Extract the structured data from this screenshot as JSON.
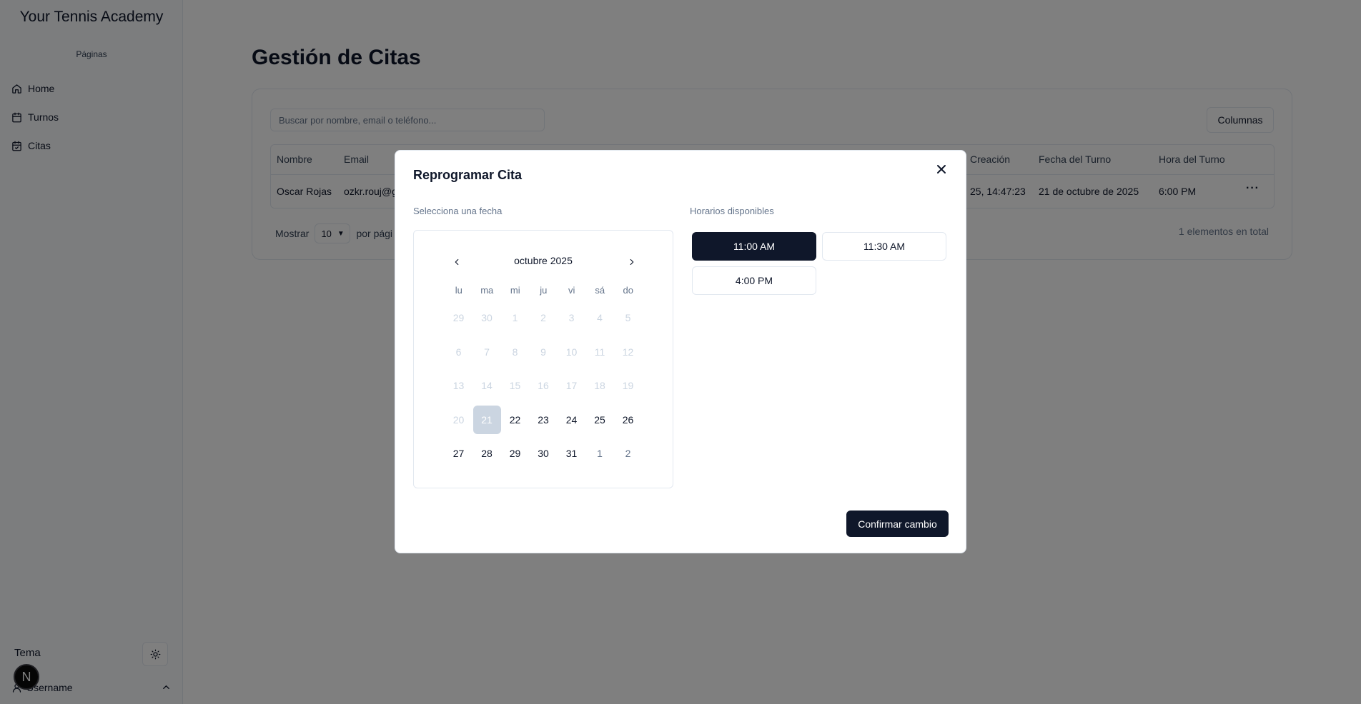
{
  "sidebar": {
    "brand": "Your Tennis Academy",
    "section_label": "Páginas",
    "items": [
      {
        "label": "Home",
        "icon": "home-icon"
      },
      {
        "label": "Turnos",
        "icon": "calendar-icon"
      },
      {
        "label": "Citas",
        "icon": "calendar-check-icon"
      }
    ],
    "theme_label": "Tema",
    "avatar_letter": "N",
    "username": "Username"
  },
  "main": {
    "title": "Gestión de Citas",
    "search_placeholder": "Buscar por nombre, email o teléfono...",
    "columns_button": "Columnas",
    "table": {
      "headers": [
        "Nombre",
        "Email",
        "Creación",
        "Fecha del Turno",
        "Hora del Turno"
      ],
      "row": [
        "Oscar Rojas",
        "ozkr.rouj@g",
        "25, 14:47:23",
        "21 de octubre de 2025",
        "6:00 PM"
      ],
      "row_menu": "···"
    },
    "footer": {
      "show_label": "Mostrar",
      "page_size": "10",
      "per_page_text": "por pági",
      "total_text": "1 elementos en total"
    }
  },
  "modal": {
    "title": "Reprogramar Cita",
    "date_label": "Selecciona una fecha",
    "slots_label": "Horarios disponibles",
    "calendar": {
      "month": "octubre 2025",
      "weekdays": [
        "lu",
        "ma",
        "mi",
        "ju",
        "vi",
        "sá",
        "do"
      ],
      "days": [
        {
          "d": "29",
          "s": "disabled"
        },
        {
          "d": "30",
          "s": "disabled"
        },
        {
          "d": "1",
          "s": "disabled"
        },
        {
          "d": "2",
          "s": "disabled"
        },
        {
          "d": "3",
          "s": "disabled"
        },
        {
          "d": "4",
          "s": "disabled"
        },
        {
          "d": "5",
          "s": "disabled"
        },
        {
          "d": "6",
          "s": "disabled"
        },
        {
          "d": "7",
          "s": "disabled"
        },
        {
          "d": "8",
          "s": "disabled"
        },
        {
          "d": "9",
          "s": "disabled"
        },
        {
          "d": "10",
          "s": "disabled"
        },
        {
          "d": "11",
          "s": "disabled"
        },
        {
          "d": "12",
          "s": "disabled"
        },
        {
          "d": "13",
          "s": "disabled"
        },
        {
          "d": "14",
          "s": "disabled"
        },
        {
          "d": "15",
          "s": "disabled"
        },
        {
          "d": "16",
          "s": "disabled"
        },
        {
          "d": "17",
          "s": "disabled"
        },
        {
          "d": "18",
          "s": "disabled"
        },
        {
          "d": "19",
          "s": "disabled"
        },
        {
          "d": "20",
          "s": "disabled"
        },
        {
          "d": "21",
          "s": "selected"
        },
        {
          "d": "22",
          "s": "normal"
        },
        {
          "d": "23",
          "s": "normal"
        },
        {
          "d": "24",
          "s": "normal"
        },
        {
          "d": "25",
          "s": "normal"
        },
        {
          "d": "26",
          "s": "normal"
        },
        {
          "d": "27",
          "s": "normal"
        },
        {
          "d": "28",
          "s": "normal"
        },
        {
          "d": "29",
          "s": "normal"
        },
        {
          "d": "30",
          "s": "normal"
        },
        {
          "d": "31",
          "s": "normal"
        },
        {
          "d": "1",
          "s": "outside"
        },
        {
          "d": "2",
          "s": "outside"
        }
      ]
    },
    "slots": [
      {
        "label": "11:00 AM",
        "active": true
      },
      {
        "label": "11:30 AM",
        "active": false
      },
      {
        "label": "4:00 PM",
        "active": false
      }
    ],
    "confirm_button": "Confirmar cambio"
  },
  "colors": {
    "primary": "#0f172a",
    "overlay": "rgba(0,0,0,0.5)",
    "selected_day": "#cbd5e1"
  }
}
